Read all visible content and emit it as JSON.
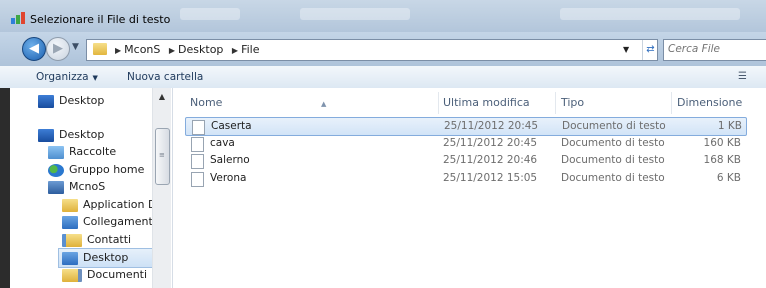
{
  "window": {
    "title": "Selezionare il File di testo"
  },
  "address": {
    "crumbs": [
      "MconS",
      "Desktop",
      "File"
    ],
    "search_placeholder": "Cerca File"
  },
  "toolbar": {
    "organize_label": "Organizza",
    "new_folder_label": "Nuova cartella"
  },
  "navpane": {
    "items": [
      {
        "label": "Desktop",
        "icon": "desktop-icon"
      },
      {
        "label": "Desktop",
        "icon": "desktop-icon"
      },
      {
        "label": "Raccolte",
        "icon": "libraries-icon"
      },
      {
        "label": "Gruppo home",
        "icon": "homegroup-icon"
      },
      {
        "label": "McnoS",
        "icon": "user-icon"
      },
      {
        "label": "Application Da",
        "icon": "folder-icon"
      },
      {
        "label": "Collegamenti",
        "icon": "links-folder-icon"
      },
      {
        "label": "Contatti",
        "icon": "contacts-folder-icon"
      },
      {
        "label": "Desktop",
        "icon": "desktop-folder-icon"
      },
      {
        "label": "Documenti",
        "icon": "documents-folder-icon"
      }
    ]
  },
  "columns": {
    "name": "Nome",
    "modified": "Ultima modifica",
    "type": "Tipo",
    "size": "Dimensione"
  },
  "files": [
    {
      "name": "Caserta",
      "modified": "25/11/2012 20:45",
      "type": "Documento di testo",
      "size": "1 KB",
      "selected": true
    },
    {
      "name": "cava",
      "modified": "25/11/2012 20:45",
      "type": "Documento di testo",
      "size": "160 KB",
      "selected": false
    },
    {
      "name": "Salerno",
      "modified": "25/11/2012 20:46",
      "type": "Documento di testo",
      "size": "168 KB",
      "selected": false
    },
    {
      "name": "Verona",
      "modified": "25/11/2012 15:05",
      "type": "Documento di testo",
      "size": "6 KB",
      "selected": false
    }
  ],
  "colors": {
    "selection": "#cde1f6",
    "selection_border": "#84acdd",
    "titlebar": "#b3c6db"
  }
}
